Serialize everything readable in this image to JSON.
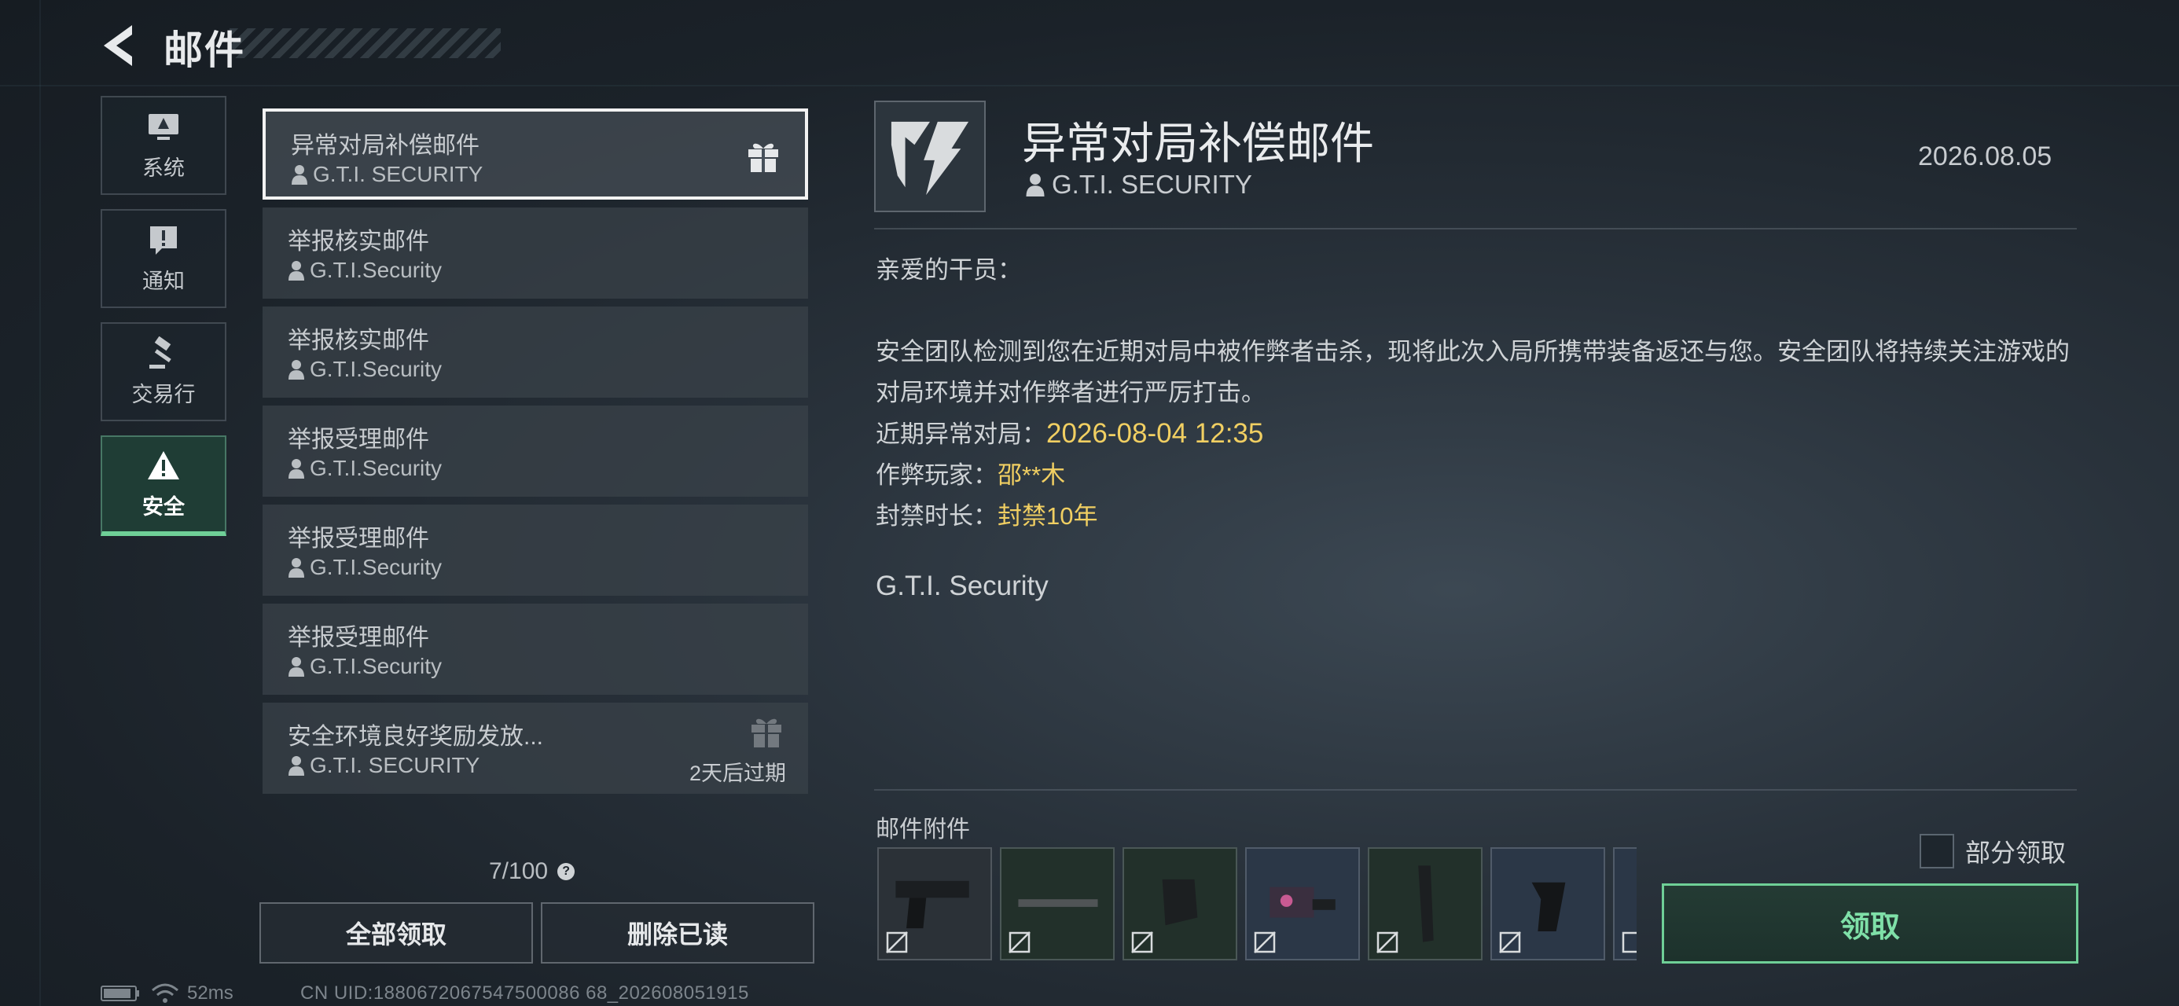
{
  "header": {
    "title": "邮件"
  },
  "categories": [
    {
      "label": "系统",
      "icon": "monitor-icon"
    },
    {
      "label": "通知",
      "icon": "alert-bubble-icon"
    },
    {
      "label": "交易行",
      "icon": "gavel-icon"
    },
    {
      "label": "安全",
      "icon": "warning-triangle-icon",
      "active": true
    }
  ],
  "mails": [
    {
      "subject": "异常对局补偿邮件",
      "sender": "G.T.I. SECURITY",
      "has_gift": true,
      "selected": true
    },
    {
      "subject": "举报核实邮件",
      "sender": "G.T.I.Security"
    },
    {
      "subject": "举报核实邮件",
      "sender": "G.T.I.Security"
    },
    {
      "subject": "举报受理邮件",
      "sender": "G.T.I.Security"
    },
    {
      "subject": "举报受理邮件",
      "sender": "G.T.I.Security"
    },
    {
      "subject": "举报受理邮件",
      "sender": "G.T.I.Security"
    },
    {
      "subject": "安全环境良好奖励发放...",
      "sender": "G.T.I. SECURITY",
      "has_gift": true,
      "expire": "2天后过期"
    }
  ],
  "mail_count": "7/100",
  "buttons": {
    "claim_all": "全部领取",
    "delete_read": "删除已读"
  },
  "status": {
    "ping": "52ms",
    "uid": "CN UID:1880672067547500086 68_202608051915"
  },
  "detail": {
    "subject": "异常对局补偿邮件",
    "sender": "G.T.I. SECURITY",
    "date": "2026.08.05",
    "greeting": "亲爱的干员：",
    "paragraph": "安全团队检测到您在近期对局中被作弊者击杀，现将此次入局所携带装备返还与您。安全团队将持续关注游戏的对局环境并对作弊者进行严厉打击。",
    "recent_match_label": "近期异常对局：",
    "recent_match_value": "2026-08-04 12:35",
    "cheater_label": "作弊玩家：",
    "cheater_value": "邵**木",
    "ban_label": "封禁时长：",
    "ban_value": "封禁10年",
    "signature": "G.T.I. Security"
  },
  "attachments": {
    "label": "邮件附件",
    "items": [
      {
        "icon": "pistol-icon"
      },
      {
        "icon": "barrel-icon"
      },
      {
        "icon": "magazine-icon"
      },
      {
        "icon": "red-dot-sight-icon"
      },
      {
        "icon": "extended-magazine-icon"
      },
      {
        "icon": "grip-icon"
      }
    ]
  },
  "partial_claim_label": "部分领取",
  "claim_label": "领取",
  "colors": {
    "accent_green": "#6fcf97",
    "highlight_yellow": "#f1cf62"
  }
}
